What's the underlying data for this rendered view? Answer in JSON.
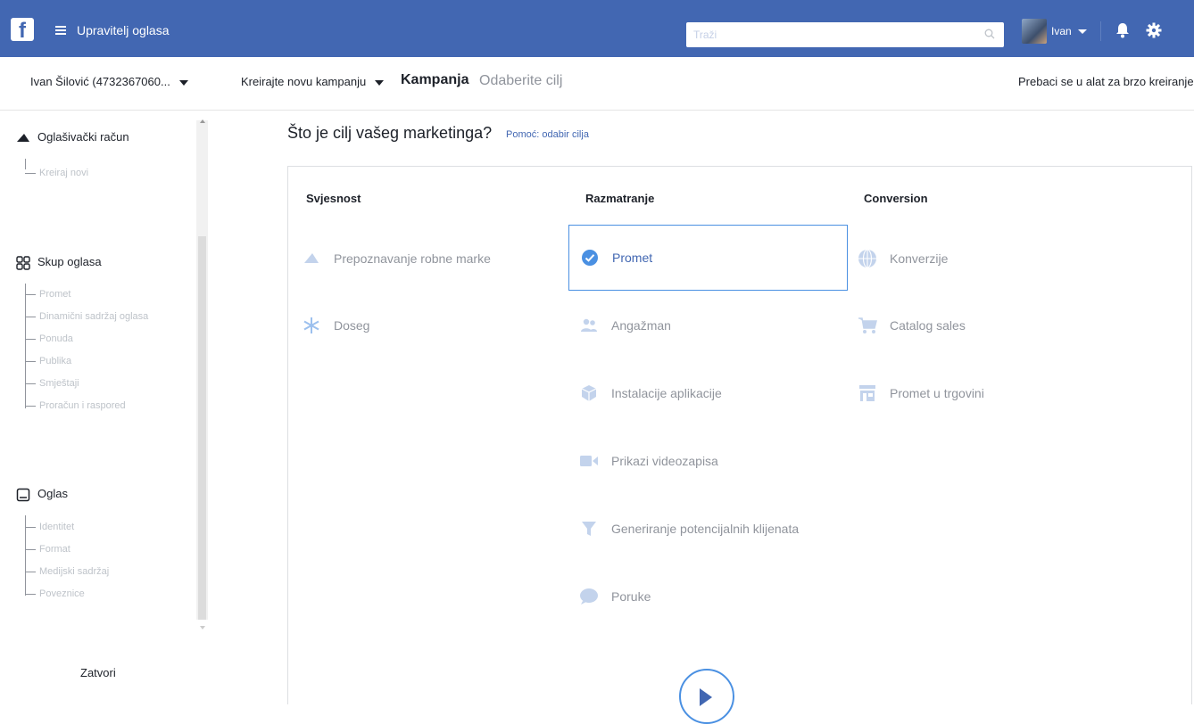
{
  "topbar": {
    "app_title": "Upravitelj oglasa",
    "search_placeholder": "Traži",
    "user_name": "Ivan",
    "accent": "#4267b2"
  },
  "subheader": {
    "account": "Ivan Šilović (4732367060...",
    "create_campaign": "Kreirajte novu kampanju",
    "crumb_bold": "Kampanja",
    "crumb_light": "Odaberite cilj",
    "switch_tool": "Prebaci se u alat za brzo kreiranje"
  },
  "sidebar": {
    "account_section": {
      "label": "Oglašivački račun",
      "icon": "megaphone-icon",
      "items": [
        "Kreiraj novi"
      ]
    },
    "adset_section": {
      "label": "Skup oglasa",
      "icon": "grid-icon",
      "items": [
        "Promet",
        "Dinamični sadržaj oglasa",
        "Ponuda",
        "Publika",
        "Smještaji",
        "Proračun i raspored"
      ]
    },
    "ad_section": {
      "label": "Oglas",
      "icon": "ad-icon",
      "items": [
        "Identitet",
        "Format",
        "Medijski sadržaj",
        "Poveznice"
      ]
    },
    "close_label": "Zatvori"
  },
  "main": {
    "title": "Što je cilj vašeg marketinga?",
    "help_link": "Pomoć: odabir cilja",
    "columns": [
      {
        "heading": "Svjesnost",
        "objectives": [
          {
            "label": "Prepoznavanje robne marke",
            "icon": "megaphone-icon"
          },
          {
            "label": "Doseg",
            "icon": "snowflake-icon"
          }
        ]
      },
      {
        "heading": "Razmatranje",
        "objectives": [
          {
            "label": "Promet",
            "icon": "check-circle-icon",
            "selected": true
          },
          {
            "label": "Angažman",
            "icon": "people-icon"
          },
          {
            "label": "Instalacije aplikacije",
            "icon": "cube-icon"
          },
          {
            "label": "Prikazi videozapisa",
            "icon": "video-icon"
          },
          {
            "label": "Generiranje potencijalnih klijenata",
            "icon": "funnel-icon"
          },
          {
            "label": "Poruke",
            "icon": "chat-icon"
          }
        ]
      },
      {
        "heading": "Conversion",
        "objectives": [
          {
            "label": "Konverzije",
            "icon": "globe-icon"
          },
          {
            "label": "Catalog sales",
            "icon": "cart-icon"
          },
          {
            "label": "Promet u trgovini",
            "icon": "store-icon"
          }
        ]
      }
    ]
  }
}
